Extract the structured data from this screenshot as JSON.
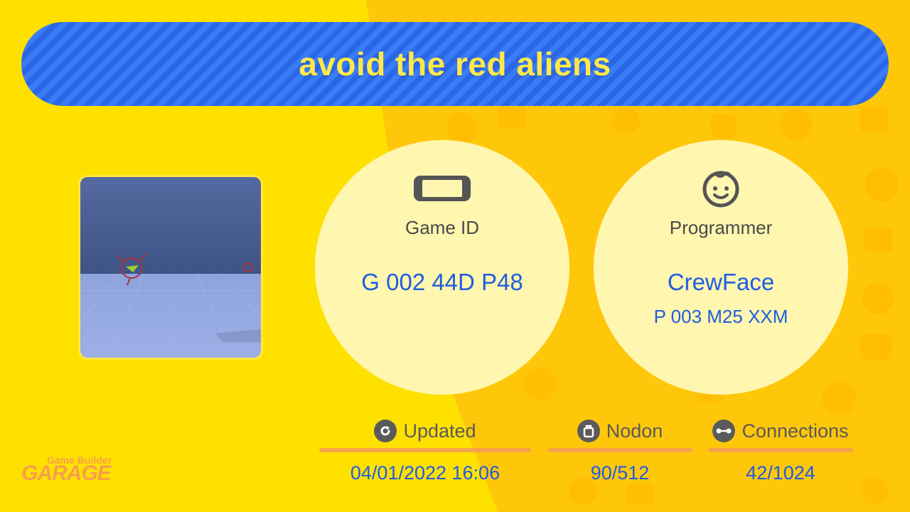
{
  "title": "avoid the red aliens",
  "game_id": {
    "icon": "switch-console-icon",
    "label": "Game ID",
    "value": "G 002 44D P48"
  },
  "programmer": {
    "icon": "face-icon",
    "label": "Programmer",
    "name": "CrewFace",
    "id": "P 003 M25 XXM"
  },
  "stats": {
    "updated": {
      "icon": "refresh-icon",
      "label": "Updated",
      "value": "04/01/2022 16:06"
    },
    "nodon": {
      "icon": "nodon-icon",
      "label": "Nodon",
      "value": "90/512"
    },
    "connections": {
      "icon": "connections-icon",
      "label": "Connections",
      "value": "42/1024"
    }
  },
  "logo": {
    "line1": "Game Builder",
    "line2": "GARAGE"
  },
  "colors": {
    "background_yellow": "#ffe100",
    "background_orange": "#ffc70a",
    "title_blue": "#2f6ff2",
    "title_text": "#ffe94a",
    "value_blue": "#1f5de0",
    "circle_fill": "#fff6b0",
    "underline_orange": "#f6a24a"
  }
}
